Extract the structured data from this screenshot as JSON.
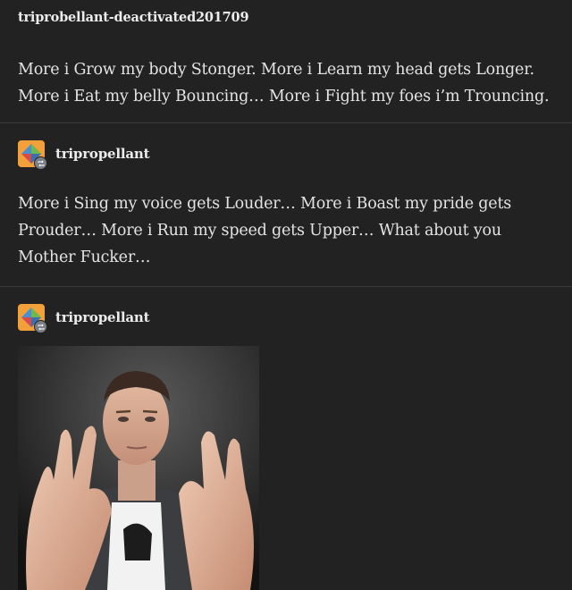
{
  "posts": [
    {
      "username": "triprobellant-deactivated201709",
      "text": "More i Grow my body Stonger. More i Learn my head gets Longer. More i Eat my belly Bouncing… More i Fight my foes i’m Trouncing."
    },
    {
      "username": "tripropellant",
      "avatar_icon": "tumblr-cube-avatar-icon",
      "badge_icon": "reblog-icon",
      "text": "More i Sing my voice gets Louder… More i Boast my pride gets Prouder… More i Run my speed gets Upper… What about you Mother Fucker…"
    },
    {
      "username": "tripropellant",
      "avatar_icon": "tumblr-cube-avatar-icon",
      "badge_icon": "reblog-icon",
      "image": "photo-of-man-reaching-hands-toward-camera"
    }
  ],
  "colors": {
    "background": "#222223",
    "divider": "#3a3a3c",
    "text": "#e4e4e4"
  }
}
